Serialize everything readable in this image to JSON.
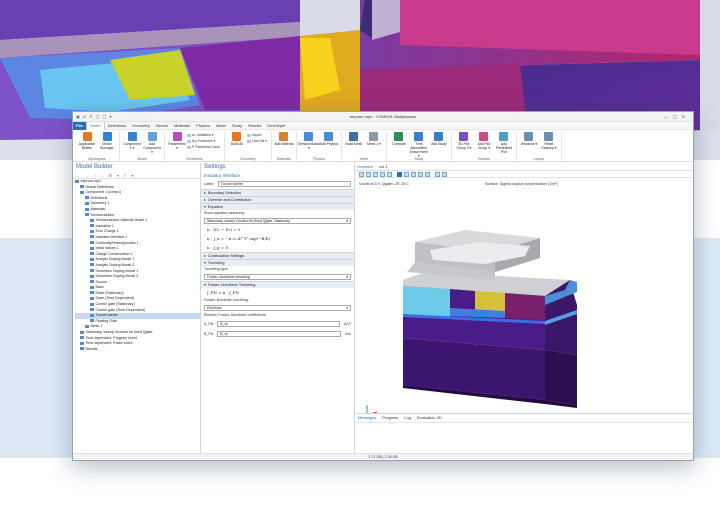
{
  "window": {
    "title": "eeprom.mph - COMSOL Multiphysics",
    "quick_access": "▣ ⎌ ⟳ ▢ ▢ ▾"
  },
  "menu_tabs": [
    "File",
    "Home",
    "Definitions",
    "Geometry",
    "Sketch",
    "Materials",
    "Physics",
    "Mesh",
    "Study",
    "Results",
    "Developer"
  ],
  "ribbon": {
    "groups": [
      {
        "caption": "Workspace",
        "buttons": [
          {
            "label": "Application Builder",
            "icon_color": "#e07a2b"
          },
          {
            "label": "Model Manager",
            "icon_color": "#3b7fc4"
          }
        ]
      },
      {
        "caption": "Model",
        "buttons": [
          {
            "label": "Component 1 ▾",
            "icon_color": "#3b7fc4"
          },
          {
            "label": "Add Component ▾",
            "icon_color": "#6aa0d8"
          }
        ]
      },
      {
        "caption": "Definitions",
        "buttons": [
          {
            "label": "Parameters ▾",
            "icon_color": "#b34fb7"
          }
        ],
        "stack": [
          "a= Variables ▾",
          "f(x) Functions ▾",
          "P Parameter Case"
        ]
      },
      {
        "caption": "Geometry",
        "buttons": [
          {
            "label": "Build All",
            "icon_color": "#e07a2b"
          }
        ],
        "stack": [
          "Import",
          "LiveLink ▾"
        ]
      },
      {
        "caption": "Materials",
        "buttons": [
          {
            "label": "Add Material",
            "icon_color": "#c9863a"
          }
        ]
      },
      {
        "caption": "Physics",
        "buttons": [
          {
            "label": "Semiconductor ▾",
            "icon_color": "#4c8ad1"
          },
          {
            "label": "Add Physics",
            "icon_color": "#4c8ad1"
          }
        ]
      },
      {
        "caption": "Mesh",
        "buttons": [
          {
            "label": "Build Mesh",
            "icon_color": "#3e6fa8"
          },
          {
            "label": "Mesh 1 ▾",
            "icon_color": "#8e9aa8"
          }
        ]
      },
      {
        "caption": "Study",
        "buttons": [
          {
            "label": "Compute",
            "icon_color": "#2e8b57"
          },
          {
            "label": "Time dependent, Erase event ▾",
            "icon_color": "#3b7fc4"
          },
          {
            "label": "Add Study",
            "icon_color": "#3b7fc4"
          }
        ]
      },
      {
        "caption": "Results",
        "buttons": [
          {
            "label": "3D Plot Group 5 ▾",
            "icon_color": "#7a4fc4"
          },
          {
            "label": "Add Plot Group ▾",
            "icon_color": "#c44f82"
          },
          {
            "label": "Add Predefined Plot",
            "icon_color": "#4f9fc4"
          }
        ]
      },
      {
        "caption": "Layout",
        "buttons": [
          {
            "label": "Windows ▾",
            "icon_color": "#6b8fb3"
          },
          {
            "label": "Reset Desktop ▾",
            "icon_color": "#6b8fb3"
          }
        ]
      }
    ]
  },
  "model_builder": {
    "title": "Model Builder",
    "toolbar": "← → ↑ ↓ ⊞ ▾ ≡ ▾",
    "items": [
      {
        "label": "eeprom.mph",
        "indent": 0
      },
      {
        "label": "Global Definitions",
        "indent": 1
      },
      {
        "label": "Component 1 (comp1)",
        "indent": 1
      },
      {
        "label": "Definitions",
        "indent": 2
      },
      {
        "label": "Geometry 1",
        "indent": 2
      },
      {
        "label": "Materials",
        "indent": 2
      },
      {
        "label": "Semiconductor",
        "indent": 2
      },
      {
        "label": "Semiconductor Material Model 1",
        "indent": 3
      },
      {
        "label": "Insulation 1",
        "indent": 3
      },
      {
        "label": "Zero Charge 1",
        "indent": 3
      },
      {
        "label": "Insulator Interface 1",
        "indent": 3
      },
      {
        "label": "Continuity/Heterojunction 1",
        "indent": 3
      },
      {
        "label": "Initial Values 1",
        "indent": 3
      },
      {
        "label": "Charge Conservation 1",
        "indent": 3
      },
      {
        "label": "Analytic Doping Model 1",
        "indent": 3
      },
      {
        "label": "Analytic Doping Model 2",
        "indent": 3
      },
      {
        "label": "Geometric Doping Model 1",
        "indent": 3
      },
      {
        "label": "Geometric Doping Model 2",
        "indent": 3
      },
      {
        "label": "Source",
        "indent": 3
      },
      {
        "label": "Base",
        "indent": 3
      },
      {
        "label": "Drain (Stationary)",
        "indent": 3
      },
      {
        "label": "Drain (Time Dependent)",
        "indent": 3
      },
      {
        "label": "Control gate (Stationary)",
        "indent": 3
      },
      {
        "label": "Control gate (Time Dependent)",
        "indent": 3
      },
      {
        "label": "Tunnel barrier",
        "indent": 3,
        "selected": true
      },
      {
        "label": "Floating Gate",
        "indent": 3
      },
      {
        "label": "Mesh 1",
        "indent": 2
      },
      {
        "label": "Stationary, sweep Vcontrol for fixed Qgate",
        "indent": 1
      },
      {
        "label": "Time dependent, Program event",
        "indent": 1
      },
      {
        "label": "Time dependent, Erase event",
        "indent": 1
      },
      {
        "label": "Results",
        "indent": 1
      }
    ]
  },
  "settings": {
    "title": "Settings",
    "subtitle": "Insulator Interface",
    "label_caption": "Label:",
    "label_value": "Tunnel barrier",
    "sections": {
      "boundary": "Boundary Selection",
      "override": "Override and Contribution",
      "equation": "Equation",
      "continuation": "Continuation Settings",
      "tunneling": "Tunneling",
      "fn": "Fowler–Nordheim Tunneling"
    },
    "show_eq_caption": "Show equation assuming:",
    "show_eq_value": "Stationary, sweep Vcontrol for fixed Qgate, Stationary",
    "eq1": "n · (D₁ − D₂) = 0",
    "eq2": "n · J_n = −n ε₀ A* T² exp(−B/E)",
    "eq3": "n · J_p = 0",
    "tunneling_type_caption": "Tunneling type:",
    "tunneling_type_value": "Fowler–Nordheim tunneling",
    "fn_eq": "J_FN = n · J_FN",
    "fn_caption": "Fowler–Nordheim tunneling:",
    "fn_value": "Electrons",
    "coef_caption": "Electron Fowler–Nordheim coefficients:",
    "coef_a_name": "A_FN",
    "coef_a_val": "A_fn",
    "coef_a_unit": "A/V²",
    "coef_b_name": "B_FN",
    "coef_b_val": "B_fn",
    "coef_b_unit": "V/m"
  },
  "graphics": {
    "tabs": [
      "Graphics",
      "cut 1"
    ],
    "caption_left": "Vcontrol=3 V, Qgate=-2E-15 C",
    "caption_center": "Surface: Signed dopant concentration (1/m³)"
  },
  "messages": {
    "tabs": [
      "Messages",
      "Progress",
      "Log",
      "Evaluation 3D"
    ]
  },
  "status_bar": "1.73 GB | 2.28 GB"
}
